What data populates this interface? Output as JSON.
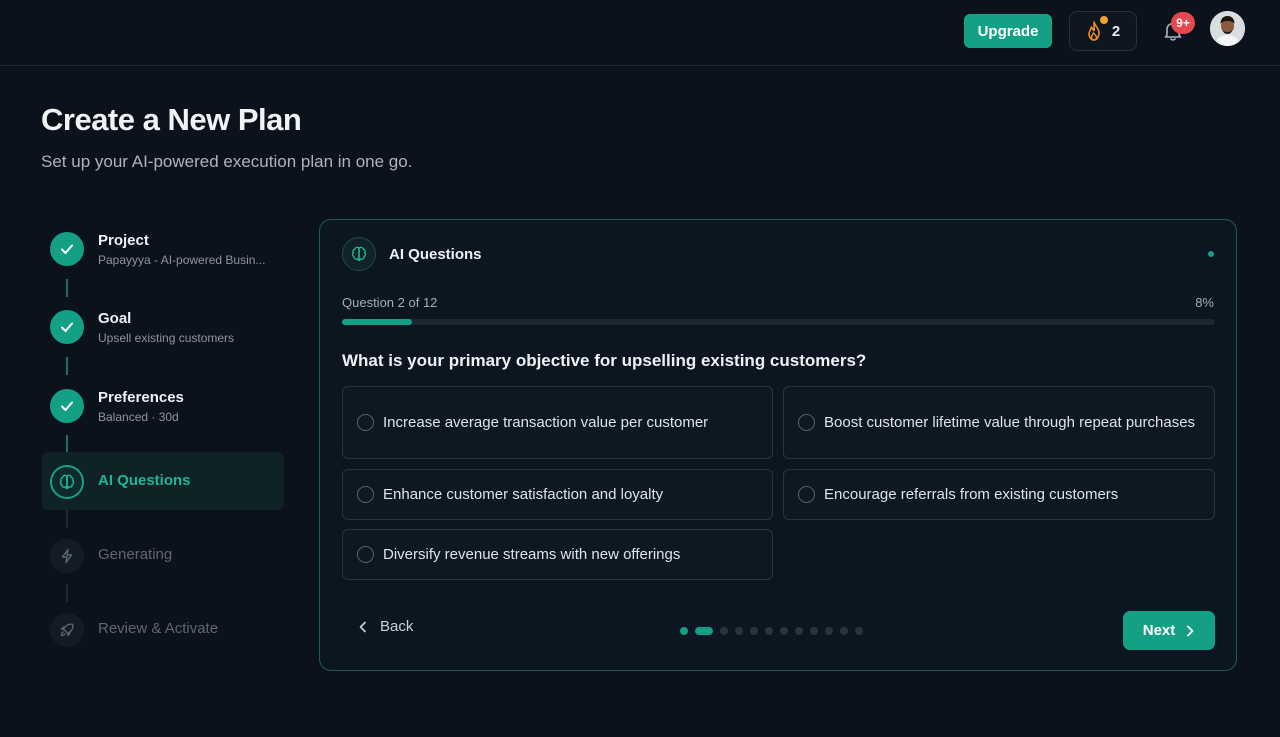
{
  "header": {
    "upgrade_label": "Upgrade",
    "streak_count": "2",
    "notification_badge": "9+",
    "avatar_icon": "user-avatar"
  },
  "page": {
    "title": "Create a New Plan",
    "subtitle": "Set up your AI-powered execution plan in one go."
  },
  "steps": [
    {
      "title": "Project",
      "subtitle": "Papayyya - AI-powered Busin...",
      "status": "done",
      "icon": "check-icon"
    },
    {
      "title": "Goal",
      "subtitle": "Upsell existing customers",
      "status": "done",
      "icon": "check-icon"
    },
    {
      "title": "Preferences",
      "subtitle": "Balanced · 30d",
      "status": "done",
      "icon": "check-icon"
    },
    {
      "title": "AI Questions",
      "subtitle": "",
      "status": "active",
      "icon": "brain-icon"
    },
    {
      "title": "Generating",
      "subtitle": "",
      "status": "pending",
      "icon": "lightning-icon"
    },
    {
      "title": "Review & Activate",
      "subtitle": "",
      "status": "pending",
      "icon": "rocket-icon"
    }
  ],
  "card": {
    "title": "AI Questions",
    "question_counter": "Question 2 of 12",
    "percent": "8%",
    "progress": 0.08,
    "question": "What is your primary objective for upselling existing customers?",
    "options": [
      "Increase average transaction value per customer",
      "Boost customer lifetime value through repeat purchases",
      "Enhance customer satisfaction and loyalty",
      "Encourage referrals from existing customers",
      "Diversify revenue streams with new offerings"
    ],
    "back_label": "Back",
    "next_label": "Next",
    "total_questions": 12,
    "current_question": 2
  },
  "colors": {
    "accent": "#14a085",
    "background": "#0b121c",
    "badge": "#e5484d",
    "streak_dot": "#f4a12a"
  }
}
